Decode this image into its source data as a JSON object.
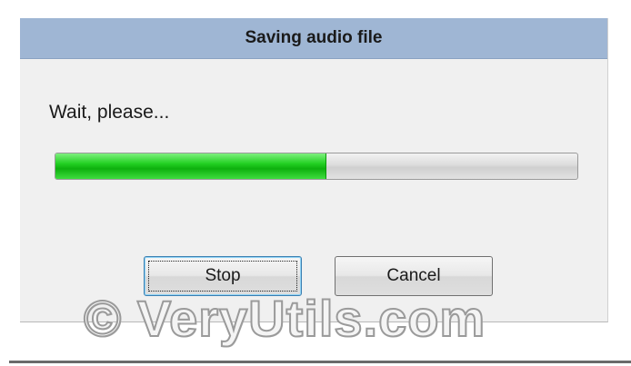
{
  "dialog": {
    "title": "Saving audio file",
    "message": "Wait, please...",
    "progress": {
      "fraction": 0.52,
      "fill_color": "#22d022"
    },
    "buttons": {
      "stop_label": "Stop",
      "cancel_label": "Cancel"
    },
    "title_bar_color": "#9fb6d4"
  },
  "watermark": {
    "text": "© VeryUtils.com"
  }
}
